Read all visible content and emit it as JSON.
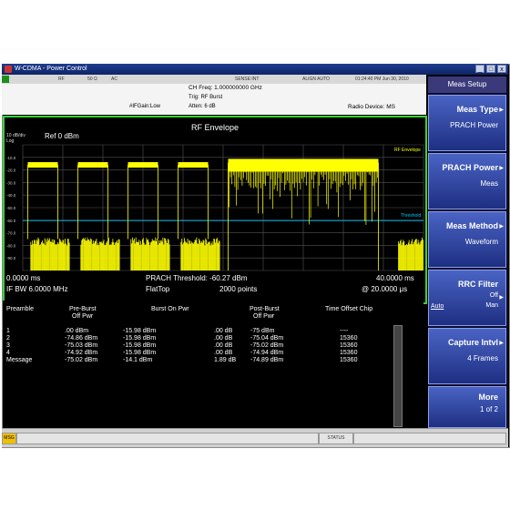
{
  "window": {
    "title": "W-CDMA - Power Control",
    "controls": {
      "minimize": "_",
      "maximize": "□",
      "close": "x"
    }
  },
  "status": {
    "rf": "RF",
    "impedance": "50 Ω",
    "coupling": "AC",
    "sense": "SENSE:INT",
    "align": "ALIGN AUTO",
    "datetime": "01:24:40 PM Jun 30, 2010"
  },
  "info": {
    "ch_freq": "CH Freq: 1.000000000 GHz",
    "trig": "Trig: RF Burst",
    "atten": "Atten: 6 dB",
    "ifgain": "#IFGain:Low",
    "radio_device": "Radio Device: MS"
  },
  "plot": {
    "title": "RF Envelope",
    "scale": "10 dB/div",
    "log": "Log",
    "ref": "Ref  0 dBm",
    "envelope_label": "RF Envelope",
    "threshold_label": "Threshold",
    "start": "0.0000 ms",
    "stop": "40.0000 ms",
    "if_bw": "IF BW 6.0000 MHz",
    "threshold": "PRACH Threshold: -60.27 dBm",
    "mode": "FlatTop",
    "points": "2000 points",
    "resolution": "@ 20.0000 μs",
    "y_ticks": [
      "-10.0",
      "-20.0",
      "-30.0",
      "-40.0",
      "-50.0",
      "-60.0",
      "-70.0",
      "-80.0",
      "-90.0"
    ]
  },
  "chart_data": {
    "type": "line",
    "title": "RF Envelope",
    "xlabel": "",
    "ylabel": "",
    "x_range_ms": [
      0,
      40
    ],
    "y_range_dbm": [
      -100,
      0
    ],
    "threshold_dbm": -60.27,
    "preambles": [
      {
        "start_ms": 0.5,
        "end_ms": 3.5,
        "burst_dbm": -15.98,
        "off_dbm": -75
      },
      {
        "start_ms": 5.5,
        "end_ms": 8.5,
        "burst_dbm": -15.98,
        "off_dbm": -75
      },
      {
        "start_ms": 10.5,
        "end_ms": 13.5,
        "burst_dbm": -15.98,
        "off_dbm": -75
      },
      {
        "start_ms": 15.5,
        "end_ms": 18.5,
        "burst_dbm": -15.98,
        "off_dbm": -75
      }
    ],
    "message": {
      "start_ms": 20.5,
      "end_ms": 35.5,
      "burst_dbm": -14.1
    }
  },
  "table": {
    "headers": [
      {
        "l1": "Preamble",
        "l2": ""
      },
      {
        "l1": "Pre-Burst",
        "l2": "Off Pwr"
      },
      {
        "l1": "Burst On Pwr",
        "l2": ""
      },
      {
        "l1": "Post-Burst",
        "l2": "Off Pwr"
      },
      {
        "l1": "Time Offset Chip",
        "l2": ""
      }
    ],
    "rows": [
      [
        "1",
        ".00 dBm",
        "-15.98 dBm",
        ".00 dB",
        "-75 dBm",
        "----"
      ],
      [
        "2",
        "-74.86 dBm",
        "-15.98 dBm",
        ".00 dB",
        "-75.04 dBm",
        "15360"
      ],
      [
        "3",
        "-75.03 dBm",
        "-15.98 dBm",
        ".00 dB",
        "-75.02 dBm",
        "15360"
      ],
      [
        "4",
        "-74.92 dBm",
        "-15.98 dBm",
        ".00 dB",
        "-74.94 dBm",
        "15360"
      ],
      [
        "Message",
        "-75.02 dBm",
        "-14.1 dBm",
        "1.89 dB",
        "-74.89 dBm",
        "15360"
      ]
    ]
  },
  "softkeys": {
    "menu_title": "Meas Setup",
    "keys": [
      {
        "l1": "Meas Type",
        "l2": "PRACH Power"
      },
      {
        "l1": "PRACH Power",
        "l2": "Meas"
      },
      {
        "l1": "Meas Method",
        "l2": "Waveform"
      },
      {
        "l1": "RRC Filter",
        "l2": "Off",
        "l3": "Man",
        "side": "Auto"
      },
      {
        "l1": "Capture Intvl",
        "l2": "4 Frames"
      },
      {
        "l1": "More",
        "l2": "1 of 2"
      }
    ]
  },
  "bottom": {
    "msg": "MSG",
    "status": "STATUS"
  },
  "colors": {
    "trace": "#ffff00",
    "threshold": "#00c8ff",
    "frame": "#39d339",
    "softkey": "#3050b8"
  }
}
